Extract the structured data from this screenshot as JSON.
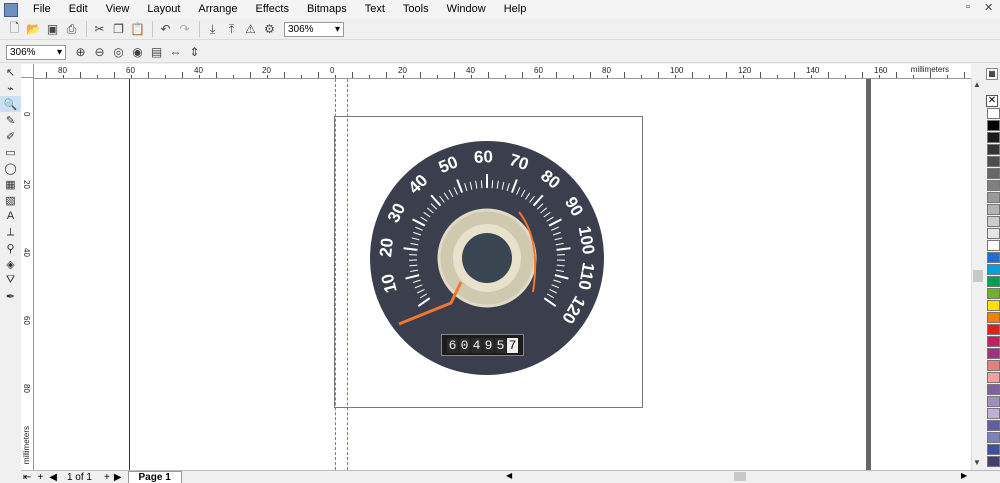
{
  "menu": [
    "File",
    "Edit",
    "View",
    "Layout",
    "Arrange",
    "Effects",
    "Bitmaps",
    "Text",
    "Tools",
    "Window",
    "Help"
  ],
  "zoom": {
    "standard_toolbar": "306%",
    "property_bar": "306%"
  },
  "ruler": {
    "unit": "millimeters",
    "horizontal_ticks": [
      "80",
      "60",
      "40",
      "20",
      "0",
      "20",
      "40",
      "60",
      "80",
      "100",
      "120",
      "140",
      "160"
    ],
    "vertical_ticks": [
      "0",
      "20",
      "40",
      "60",
      "80"
    ]
  },
  "page_nav": {
    "counter": "1 of 1",
    "tab": "Page 1"
  },
  "speedometer": {
    "dial_numbers": [
      "10",
      "20",
      "30",
      "40",
      "50",
      "60",
      "70",
      "80",
      "90",
      "100",
      "110",
      "120"
    ],
    "odometer": [
      "6",
      "0",
      "4",
      "9",
      "5",
      "7"
    ],
    "colors": {
      "face": "#3b3e4c",
      "needle": "#f07830",
      "numeral": "#ffffff"
    }
  },
  "palette": [
    "#ffffff",
    "#000000",
    "#1a1a1a",
    "#333333",
    "#4d4d4d",
    "#666666",
    "#808080",
    "#999999",
    "#b3b3b3",
    "#cccccc",
    "#e6e6e6",
    "#ffffff",
    "#1e6ed8",
    "#00a0e0",
    "#00a050",
    "#70b030",
    "#ffe000",
    "#f08000",
    "#e02020",
    "#c02060",
    "#a03080",
    "#e08080",
    "#f0a0a0",
    "#8060a0",
    "#a090c0",
    "#c0b0d8",
    "#6060a0",
    "#8080c0",
    "#4050a0",
    "#404070"
  ]
}
